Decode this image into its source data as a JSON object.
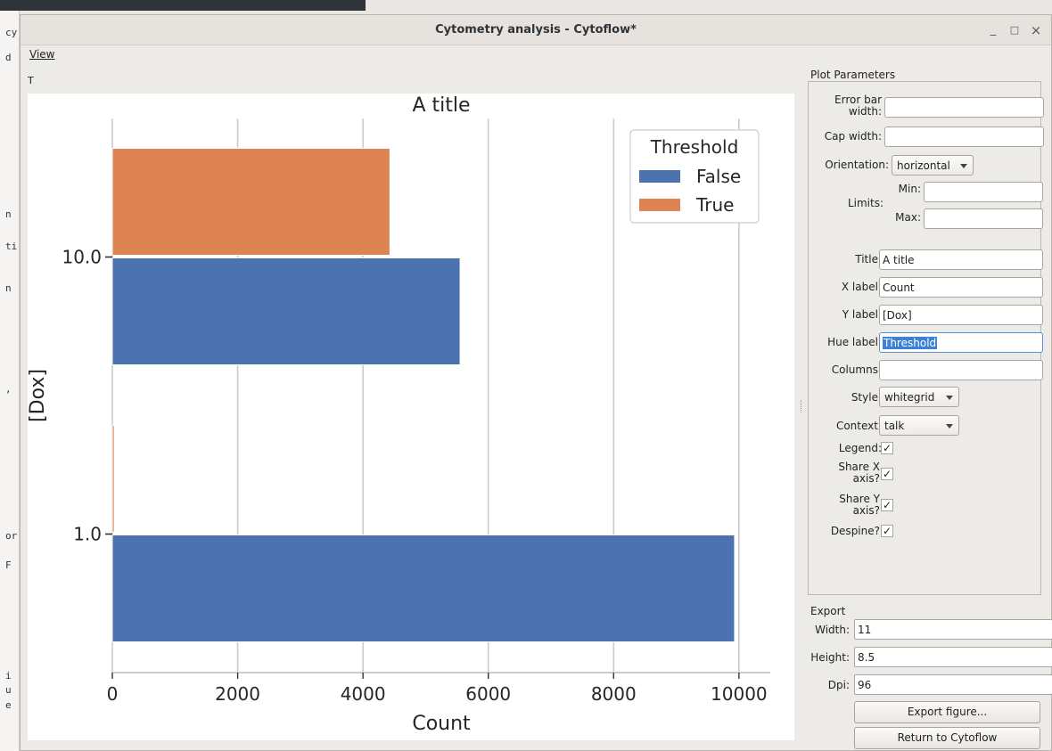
{
  "window": {
    "title": "Cytometry analysis - Cytoflow*",
    "controls": {
      "minimize": "_",
      "maximize": "□",
      "close": "×"
    }
  },
  "menubar": {
    "view": "View"
  },
  "plot_toolbar_label": "T",
  "background_left_fragments": [
    "cy",
    "d",
    "n",
    "ti",
    "n",
    ",",
    "or",
    "F",
    "i",
    "u",
    "e"
  ],
  "chart_data": {
    "type": "bar",
    "orientation": "horizontal",
    "title": "A title",
    "xlabel": "Count",
    "ylabel": "[Dox]",
    "categories": [
      "10.0",
      "1.0"
    ],
    "series": [
      {
        "name": "False",
        "color": "#4c72b0",
        "values": [
          5550,
          9930
        ]
      },
      {
        "name": "True",
        "color": "#dd8452",
        "values": [
          4430,
          30
        ]
      }
    ],
    "xlim": [
      0,
      10500
    ],
    "xticks": [
      0,
      2000,
      4000,
      6000,
      8000,
      10000
    ],
    "xtick_labels": [
      "0",
      "2000",
      "4000",
      "6000",
      "8000",
      "10000"
    ],
    "grid": true,
    "style": "whitegrid",
    "legend": {
      "title": "Threshold",
      "placement": "top-right",
      "entries": [
        "False",
        "True"
      ]
    }
  },
  "plot_parameters": {
    "header": "Plot Parameters",
    "error_bar_width": {
      "label": "Error bar width:",
      "value": ""
    },
    "cap_width": {
      "label": "Cap width:",
      "value": ""
    },
    "orientation": {
      "label": "Orientation:",
      "value": "horizontal"
    },
    "limits": {
      "label": "Limits:",
      "min_label": "Min:",
      "max_label": "Max:",
      "min": "",
      "max": ""
    },
    "title": {
      "label": "Title:",
      "value": "A title"
    },
    "x_label": {
      "label": "X label:",
      "value": "Count"
    },
    "y_label": {
      "label": "Y label:",
      "value": "[Dox]"
    },
    "hue_label": {
      "label": "Hue label:",
      "value": "Threshold"
    },
    "columns": {
      "label": "Columns:",
      "value": ""
    },
    "style": {
      "label": "Style:",
      "value": "whitegrid"
    },
    "context": {
      "label": "Context:",
      "value": "talk"
    },
    "legend": {
      "label": "Legend:",
      "checked": "✓"
    },
    "share_x": {
      "label": "Share X axis?",
      "checked": "✓"
    },
    "share_y": {
      "label": "Share Y axis?",
      "checked": "✓"
    },
    "despine": {
      "label": "Despine?",
      "checked": "✓"
    }
  },
  "export": {
    "header": "Export",
    "width": {
      "label": "Width:",
      "value": "11"
    },
    "height": {
      "label": "Height:",
      "value": "8.5"
    },
    "dpi": {
      "label": "Dpi:",
      "value": "96"
    },
    "export_button": "Export figure...",
    "return_button": "Return to Cytoflow"
  }
}
